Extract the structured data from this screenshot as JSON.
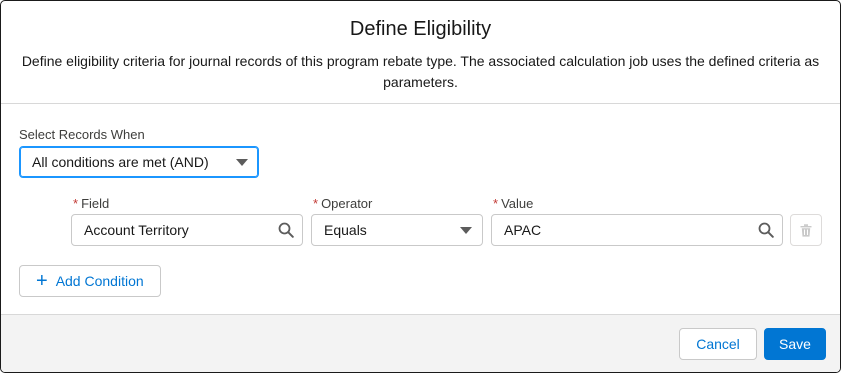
{
  "header": {
    "title": "Define Eligibility",
    "subtitle": "Define eligibility criteria for journal records of this program rebate type. The associated calculation job uses the defined criteria as parameters."
  },
  "select_records": {
    "label": "Select Records When",
    "value": "All conditions are met (AND)"
  },
  "condition": {
    "required_marker": "*",
    "field": {
      "label": "Field",
      "value": "Account Territory",
      "icon": "search-icon"
    },
    "operator": {
      "label": "Operator",
      "value": "Equals"
    },
    "value": {
      "label": "Value",
      "value": "APAC",
      "icon": "search-icon"
    },
    "delete_icon": "trash-icon"
  },
  "add_condition": {
    "label": "Add Condition",
    "icon": "plus-icon"
  },
  "footer": {
    "cancel_label": "Cancel",
    "save_label": "Save"
  },
  "colors": {
    "brand": "#0176d3",
    "focus": "#1b96ff",
    "required": "#c23934",
    "footer_bg": "#f3f3f3"
  }
}
